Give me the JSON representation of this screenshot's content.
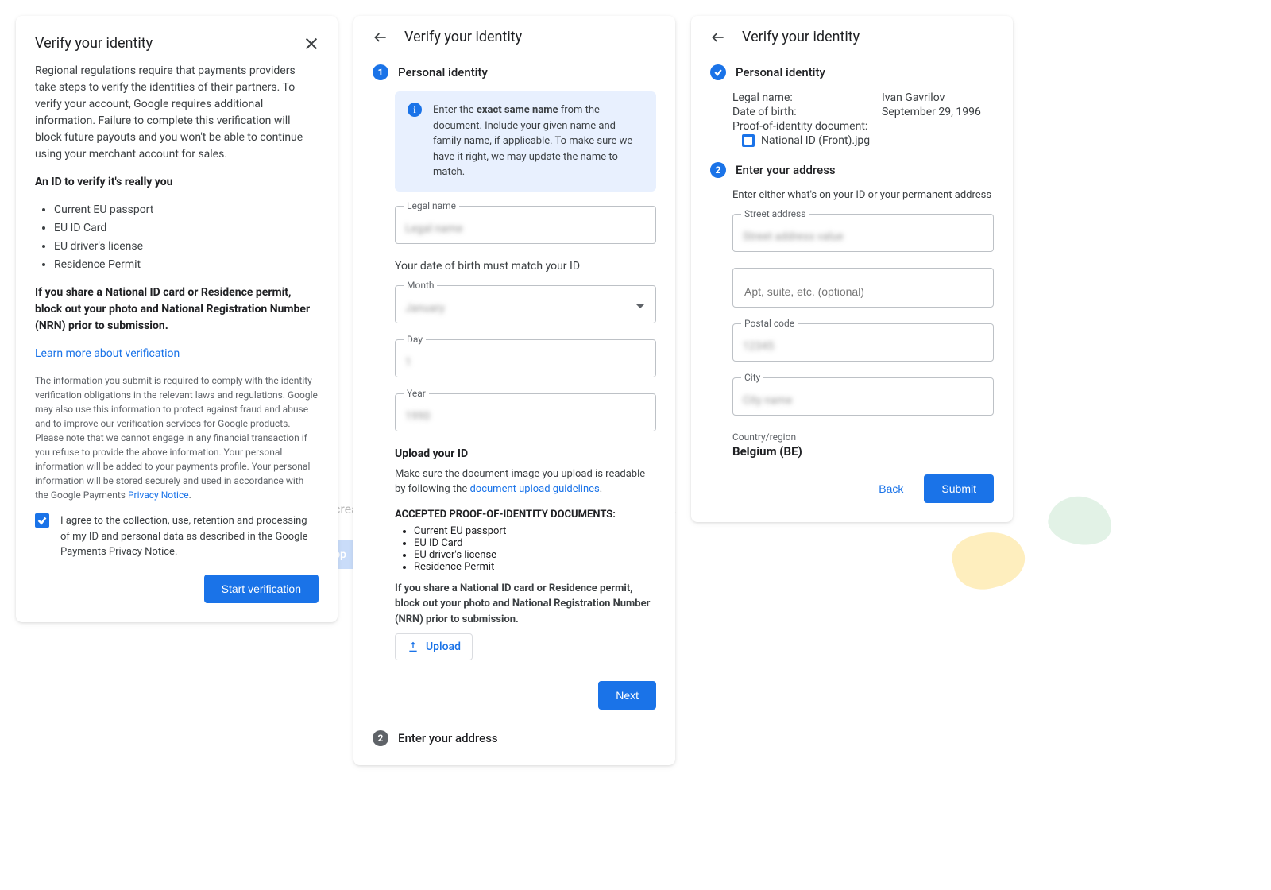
{
  "bg": {
    "text": "Apps you create will appear here. Get started by creating your\nfirst app.",
    "create_btn": "Create app"
  },
  "panel1": {
    "title": "Verify your identity",
    "intro": "Regional regulations require that payments providers take steps to verify the identities of their partners. To verify your account, Google requires additional information. Failure to complete this verification will block future payouts and you won't be able to continue using your merchant account for sales.",
    "id_heading": "An ID to verify it's really you",
    "id_list": [
      "Current EU passport",
      "EU ID Card",
      "EU driver's license",
      "Residence Permit"
    ],
    "blockout": "If you share a National ID card or Residence permit, block out your photo and National Registration Number (NRN) prior to submission.",
    "learn_more": "Learn more about verification",
    "fineprint": "The information you submit is required to comply with the identity verification obligations in the relevant laws and regulations. Google may also use this information to protect against fraud and abuse and to improve our verification services for Google products. Please note that we cannot engage in any financial transaction if you refuse to provide the above information. Your personal information will be added to your payments profile. Your personal information will be stored securely and used in accordance with the Google Payments ",
    "privacy": "Privacy Notice",
    "consent": "I agree to the collection, use, retention and processing of my ID and personal data as described in the Google Payments Privacy Notice.",
    "start_btn": "Start verification"
  },
  "panel2": {
    "title": "Verify your identity",
    "step1_title": "Personal identity",
    "info_pre": "Enter the ",
    "info_bold": "exact same name",
    "info_post": " from the document. Include your given name and family name, if applicable. To make sure we have it right, we may update the name to match.",
    "f_legal": "Legal name",
    "dob_helper": "Your date of birth must match your ID",
    "f_month": "Month",
    "f_day": "Day",
    "f_year": "Year",
    "upload_head": "Upload your ID",
    "upload_note_pre": "Make sure the document image you upload is readable by following the ",
    "upload_note_link": "document upload guidelines",
    "accepted": "ACCEPTED PROOF-OF-IDENTITY DOCUMENTS:",
    "id_list": [
      "Current EU passport",
      "EU ID Card",
      "EU driver's license",
      "Residence Permit"
    ],
    "blockout": "If you share a National ID card or Residence permit, block out your photo and National Registration Number (NRN) prior to submission.",
    "upload_btn": "Upload",
    "next_btn": "Next",
    "step2_title": "Enter your address"
  },
  "panel3": {
    "title": "Verify your identity",
    "step1_title": "Personal identity",
    "summary": {
      "legal_k": "Legal name:",
      "legal_v": "Ivan Gavrilov",
      "dob_k": "Date of birth:",
      "dob_v": "September 29, 1996",
      "doc_k": "Proof-of-identity document:",
      "doc_file": "National ID (Front).jpg"
    },
    "step2_title": "Enter your address",
    "addr_helper": "Enter either what's on your ID or your permanent address",
    "f_street": "Street address",
    "f_apt": "Apt, suite, etc. (optional)",
    "f_postal": "Postal code",
    "f_city": "City",
    "country_label": "Country/region",
    "country_val": "Belgium (BE)",
    "back_btn": "Back",
    "submit_btn": "Submit"
  }
}
